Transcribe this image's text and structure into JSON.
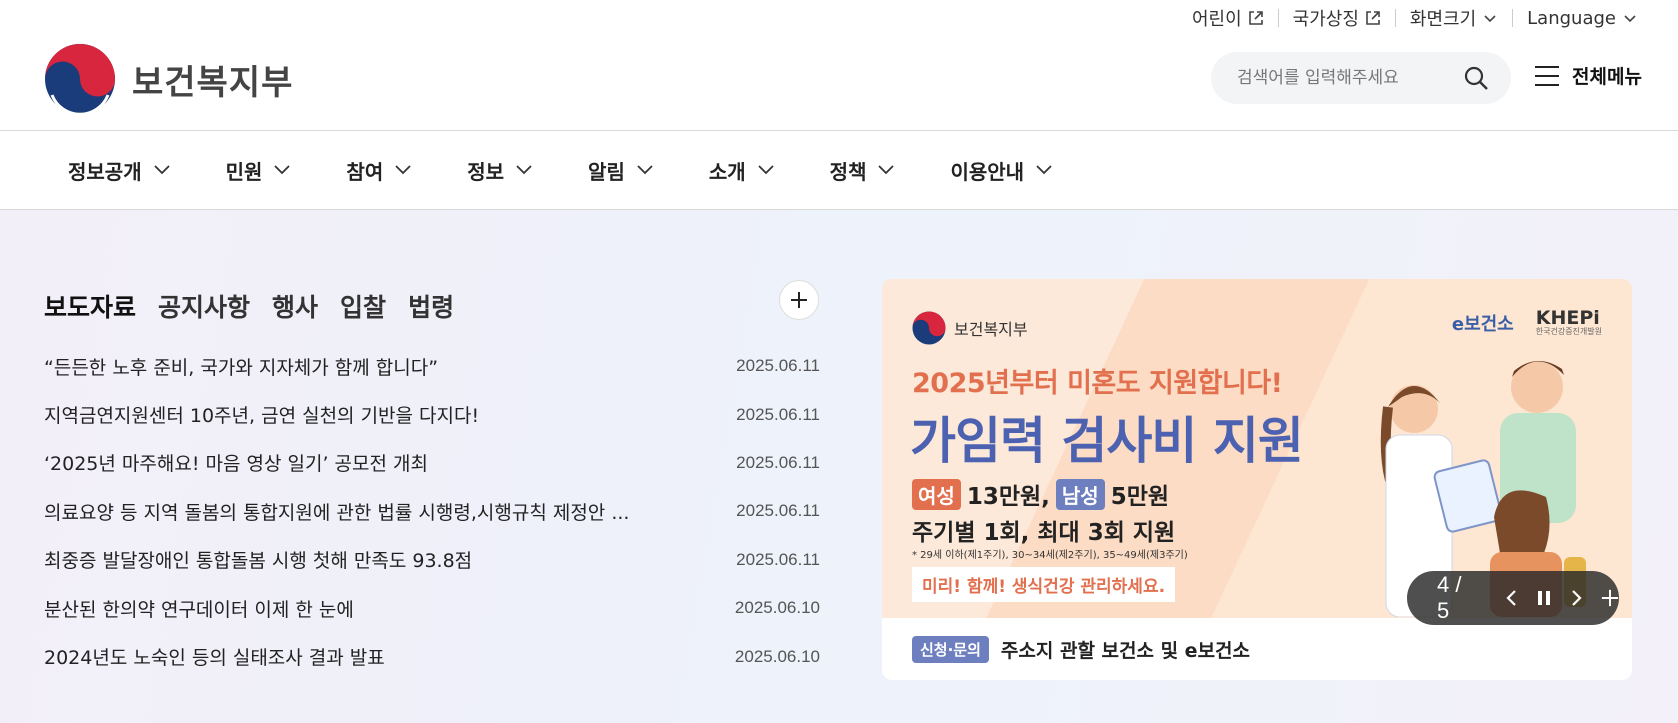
{
  "util_links": [
    {
      "label": "어린이",
      "external": true
    },
    {
      "label": "국가상징",
      "external": true
    },
    {
      "label": "화면크기",
      "dropdown": true
    },
    {
      "label": "Language",
      "dropdown": true
    }
  ],
  "logo": {
    "name": "보건복지부"
  },
  "search": {
    "placeholder": "검색어를 입력해주세요"
  },
  "all_menu": {
    "label": "전체메뉴"
  },
  "gnb": [
    "정보공개",
    "민원",
    "참여",
    "정보",
    "알림",
    "소개",
    "정책",
    "이용안내"
  ],
  "news_tabs": [
    "보도자료",
    "공지사항",
    "행사",
    "입찰",
    "법령"
  ],
  "news": [
    {
      "title": "“든든한 노후 준비, 국가와 지자체가 함께 합니다”",
      "date": "2025.06.11"
    },
    {
      "title": "지역금연지원센터 10주년, 금연 실천의 기반을 다지다!",
      "date": "2025.06.11"
    },
    {
      "title": "‘2025년 마주해요! 마음 영상 일기’ 공모전 개최",
      "date": "2025.06.11"
    },
    {
      "title": "의료요양 등 지역 돌봄의 통합지원에 관한 법률 시행령,시행규칙 제정안 ...",
      "date": "2025.06.11"
    },
    {
      "title": "최중증 발달장애인 통합돌봄 시행 첫해 만족도 93.8점",
      "date": "2025.06.11"
    },
    {
      "title": "분산된 한의약 연구데이터 이제 한 눈에",
      "date": "2025.06.10"
    },
    {
      "title": "2024년도 노숙인 등의 실태조사 결과 발표",
      "date": "2025.06.10"
    }
  ],
  "banner": {
    "org": "보건복지부",
    "partner1": "e보건소",
    "partner2": "KHEPi",
    "partner2_sub": "한국건강증진개발원",
    "headline_small": "2025년부터 미혼도 지원합니다!",
    "headline_big": "가임력 검사비 지원",
    "tag_female": "여성",
    "amount_female": "13만원,",
    "tag_male": "남성",
    "amount_male": "5만원",
    "line2": "주기별 1회, 최대 3회 지원",
    "fine_print": "* 29세 이하(제1주기), 30~34세(제2주기), 35~49세(제3주기)",
    "cta": "미리! 함께! 생식건강 관리하세요.",
    "footer_chip": "신청·문의",
    "footer_text": "주소지 관할 보건소 및 e보건소",
    "colors": {
      "female": "#e2704f",
      "male": "#6d7fbf"
    }
  },
  "carousel": {
    "current": 4,
    "total": 5,
    "counter": "4 / 5"
  }
}
